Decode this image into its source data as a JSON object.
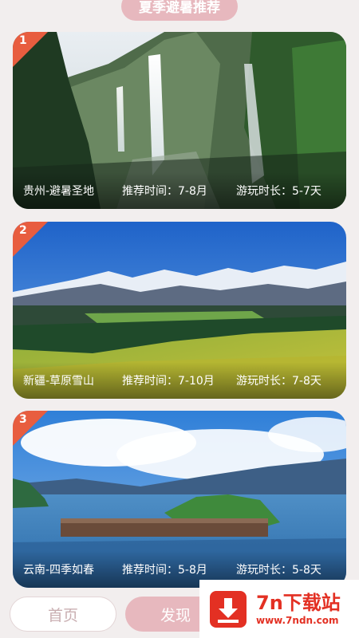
{
  "header": {
    "title": "夏季避暑推荐"
  },
  "cards": [
    {
      "index": "1",
      "title": "贵州-避暑圣地",
      "recommended_time": "推荐时间：7-8月",
      "duration": "游玩时长：5-7天",
      "scene": "waterfall-cliffs"
    },
    {
      "index": "2",
      "title": "新疆-草原雪山",
      "recommended_time": "推荐时间：7-10月",
      "duration": "游玩时长：7-8天",
      "scene": "snow-mountain-grassland"
    },
    {
      "index": "3",
      "title": "云南-四季如春",
      "recommended_time": "推荐时间：5-8月",
      "duration": "游玩时长：5-8天",
      "scene": "lake-island"
    }
  ],
  "bottom_nav": {
    "home": "首页",
    "discover": "发现"
  },
  "watermark": {
    "brand": "7n下载站",
    "url": "www.7ndn.com"
  },
  "colors": {
    "accent": "#e7b8be",
    "badge": "#e85d3f",
    "watermark": "#e33023"
  }
}
